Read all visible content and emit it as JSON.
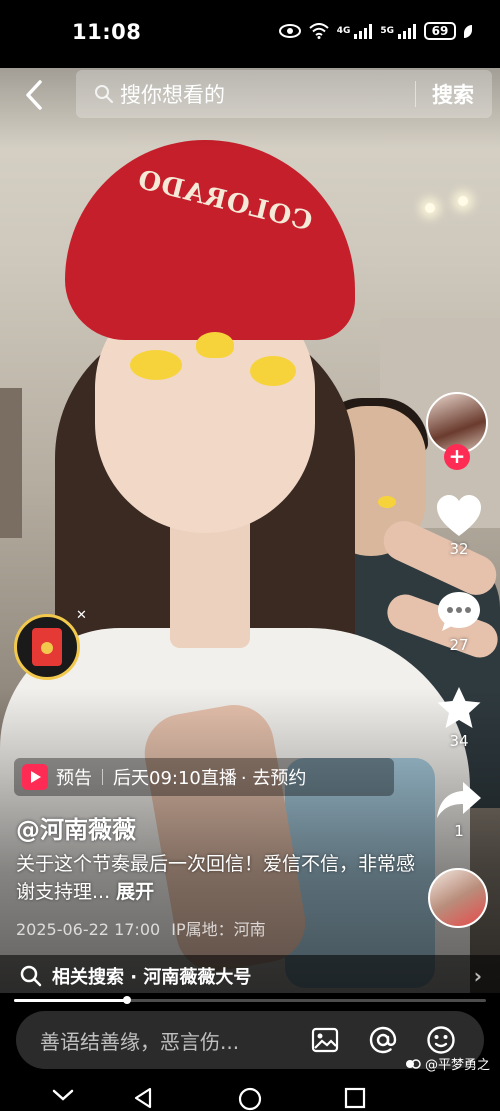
{
  "status_bar": {
    "time": "11:08",
    "net1": "4G",
    "net2": "5G",
    "battery": "69"
  },
  "search": {
    "placeholder": "搜你想看的",
    "button": "搜索"
  },
  "rail": {
    "like_count": "32",
    "comment_count": "27",
    "favorite_count": "34",
    "share_count": "1"
  },
  "preview": {
    "label": "预告",
    "schedule": "后天09:10直播",
    "action": "· 去预约"
  },
  "post": {
    "author": "@河南薇薇",
    "caption": "关于这个节奏最后一次回信！爱信不信，非常感谢支持理...",
    "expand": "展开",
    "date": "2025-06-22 17:00",
    "ip": "IP属地：河南"
  },
  "related": {
    "label": "相关搜索 · 河南薇薇大号"
  },
  "playback": {
    "progress": 0.24
  },
  "comment": {
    "placeholder": "善语结善缘，恶言伤..."
  },
  "watermark": {
    "text": "@平梦勇之"
  },
  "colors": {
    "accent": "#fe2c55",
    "cap": "#c51f2b",
    "sticker": "#f7d33b"
  },
  "icons": [
    "back-icon",
    "search-icon",
    "heart-icon",
    "comment-icon",
    "star-icon",
    "share-icon",
    "image-icon",
    "at-icon",
    "emoji-icon"
  ]
}
